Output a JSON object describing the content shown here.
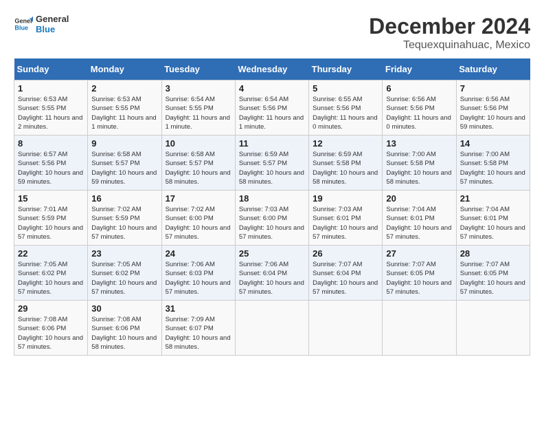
{
  "header": {
    "logo_line1": "General",
    "logo_line2": "Blue",
    "month_title": "December 2024",
    "location": "Tequexquinahuac, Mexico"
  },
  "days_of_week": [
    "Sunday",
    "Monday",
    "Tuesday",
    "Wednesday",
    "Thursday",
    "Friday",
    "Saturday"
  ],
  "weeks": [
    [
      {
        "day": "1",
        "sunrise": "6:53 AM",
        "sunset": "5:55 PM",
        "daylight": "11 hours and 2 minutes."
      },
      {
        "day": "2",
        "sunrise": "6:53 AM",
        "sunset": "5:55 PM",
        "daylight": "11 hours and 1 minute."
      },
      {
        "day": "3",
        "sunrise": "6:54 AM",
        "sunset": "5:55 PM",
        "daylight": "11 hours and 1 minute."
      },
      {
        "day": "4",
        "sunrise": "6:54 AM",
        "sunset": "5:56 PM",
        "daylight": "11 hours and 1 minute."
      },
      {
        "day": "5",
        "sunrise": "6:55 AM",
        "sunset": "5:56 PM",
        "daylight": "11 hours and 0 minutes."
      },
      {
        "day": "6",
        "sunrise": "6:56 AM",
        "sunset": "5:56 PM",
        "daylight": "11 hours and 0 minutes."
      },
      {
        "day": "7",
        "sunrise": "6:56 AM",
        "sunset": "5:56 PM",
        "daylight": "10 hours and 59 minutes."
      }
    ],
    [
      {
        "day": "8",
        "sunrise": "6:57 AM",
        "sunset": "5:56 PM",
        "daylight": "10 hours and 59 minutes."
      },
      {
        "day": "9",
        "sunrise": "6:58 AM",
        "sunset": "5:57 PM",
        "daylight": "10 hours and 59 minutes."
      },
      {
        "day": "10",
        "sunrise": "6:58 AM",
        "sunset": "5:57 PM",
        "daylight": "10 hours and 58 minutes."
      },
      {
        "day": "11",
        "sunrise": "6:59 AM",
        "sunset": "5:57 PM",
        "daylight": "10 hours and 58 minutes."
      },
      {
        "day": "12",
        "sunrise": "6:59 AM",
        "sunset": "5:58 PM",
        "daylight": "10 hours and 58 minutes."
      },
      {
        "day": "13",
        "sunrise": "7:00 AM",
        "sunset": "5:58 PM",
        "daylight": "10 hours and 58 minutes."
      },
      {
        "day": "14",
        "sunrise": "7:00 AM",
        "sunset": "5:58 PM",
        "daylight": "10 hours and 57 minutes."
      }
    ],
    [
      {
        "day": "15",
        "sunrise": "7:01 AM",
        "sunset": "5:59 PM",
        "daylight": "10 hours and 57 minutes."
      },
      {
        "day": "16",
        "sunrise": "7:02 AM",
        "sunset": "5:59 PM",
        "daylight": "10 hours and 57 minutes."
      },
      {
        "day": "17",
        "sunrise": "7:02 AM",
        "sunset": "6:00 PM",
        "daylight": "10 hours and 57 minutes."
      },
      {
        "day": "18",
        "sunrise": "7:03 AM",
        "sunset": "6:00 PM",
        "daylight": "10 hours and 57 minutes."
      },
      {
        "day": "19",
        "sunrise": "7:03 AM",
        "sunset": "6:01 PM",
        "daylight": "10 hours and 57 minutes."
      },
      {
        "day": "20",
        "sunrise": "7:04 AM",
        "sunset": "6:01 PM",
        "daylight": "10 hours and 57 minutes."
      },
      {
        "day": "21",
        "sunrise": "7:04 AM",
        "sunset": "6:01 PM",
        "daylight": "10 hours and 57 minutes."
      }
    ],
    [
      {
        "day": "22",
        "sunrise": "7:05 AM",
        "sunset": "6:02 PM",
        "daylight": "10 hours and 57 minutes."
      },
      {
        "day": "23",
        "sunrise": "7:05 AM",
        "sunset": "6:02 PM",
        "daylight": "10 hours and 57 minutes."
      },
      {
        "day": "24",
        "sunrise": "7:06 AM",
        "sunset": "6:03 PM",
        "daylight": "10 hours and 57 minutes."
      },
      {
        "day": "25",
        "sunrise": "7:06 AM",
        "sunset": "6:04 PM",
        "daylight": "10 hours and 57 minutes."
      },
      {
        "day": "26",
        "sunrise": "7:07 AM",
        "sunset": "6:04 PM",
        "daylight": "10 hours and 57 minutes."
      },
      {
        "day": "27",
        "sunrise": "7:07 AM",
        "sunset": "6:05 PM",
        "daylight": "10 hours and 57 minutes."
      },
      {
        "day": "28",
        "sunrise": "7:07 AM",
        "sunset": "6:05 PM",
        "daylight": "10 hours and 57 minutes."
      }
    ],
    [
      {
        "day": "29",
        "sunrise": "7:08 AM",
        "sunset": "6:06 PM",
        "daylight": "10 hours and 57 minutes."
      },
      {
        "day": "30",
        "sunrise": "7:08 AM",
        "sunset": "6:06 PM",
        "daylight": "10 hours and 58 minutes."
      },
      {
        "day": "31",
        "sunrise": "7:09 AM",
        "sunset": "6:07 PM",
        "daylight": "10 hours and 58 minutes."
      },
      null,
      null,
      null,
      null
    ]
  ]
}
